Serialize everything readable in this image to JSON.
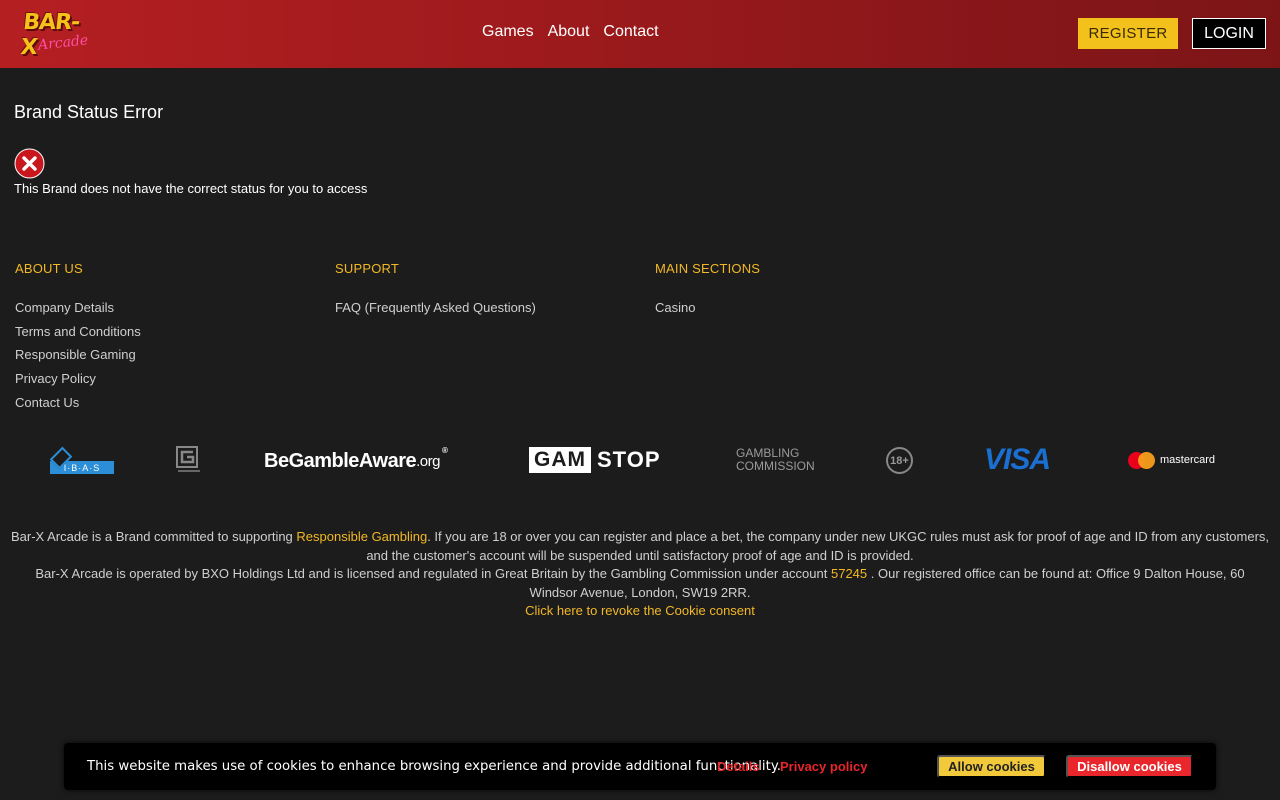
{
  "header": {
    "logo_main": "BAR-X",
    "logo_sub": "Arcade",
    "nav": [
      "Games",
      "About",
      "Contact"
    ],
    "register_label": "REGISTER",
    "login_label": "LOGIN"
  },
  "error": {
    "title": "Brand Status Error",
    "message": "This Brand does not have the correct status for you to access",
    "icon": "error-x-icon"
  },
  "footer": {
    "about": {
      "heading": "ABOUT US",
      "items": [
        "Company Details",
        "Terms and Conditions",
        "Responsible Gaming",
        "Privacy Policy",
        "Contact Us"
      ]
    },
    "support": {
      "heading": "SUPPORT",
      "items": [
        "FAQ (Frequently Asked Questions)"
      ]
    },
    "main": {
      "heading": "MAIN SECTIONS",
      "items": [
        "Casino"
      ]
    }
  },
  "logos": {
    "ibas": "I·B·A·S",
    "bga_main": "BeGambleAware",
    "bga_org": ".org",
    "bga_reg": "®",
    "gamstop_box": "GAM",
    "gamstop_txt": "STOP",
    "gc_line1": "GAMBLING",
    "gc_line2": "COMMISSION",
    "age": "18+",
    "visa": "VISA",
    "mastercard": "mastercard"
  },
  "disclaimer": {
    "p1_before": "Bar-X Arcade is a Brand committed to supporting ",
    "p1_link": "Responsible Gambling",
    "p1_after": ". If you are 18 or over you can register and place a bet, the company under new UKGC rules must ask for proof of age and ID from any customers, and the customer's account will be suspended until satisfactory proof of age and ID is provided.",
    "p2_before": "Bar-X Arcade is operated by BXO Holdings Ltd and is licensed and regulated in Great Britain by the Gambling Commission under account ",
    "p2_link": "57245",
    "p2_after": " . Our registered office can be found at: Office 9 Dalton House, 60 Windsor Avenue, London, SW19 2RR.",
    "revoke": "Click here to revoke the Cookie consent"
  },
  "cookie": {
    "message": "This website makes use of cookies to enhance browsing experience and provide additional functionality.",
    "details": "Details",
    "privacy": "Privacy policy",
    "allow": "Allow cookies",
    "disallow": "Disallow cookies"
  },
  "colors": {
    "header_red": "#9c1a1c",
    "accent_yellow": "#f2b825",
    "cookie_red": "#e8262b"
  }
}
